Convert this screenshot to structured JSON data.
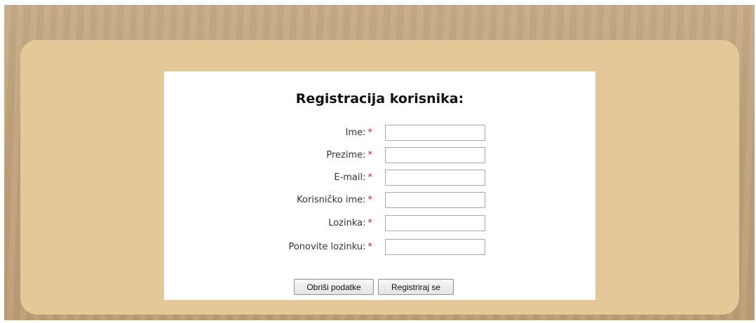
{
  "form": {
    "title": "Registracija korisnika:",
    "required_marker": "*",
    "fields": [
      {
        "label": "Ime:",
        "value": ""
      },
      {
        "label": "Prezime:",
        "value": ""
      },
      {
        "label": "E-mail:",
        "value": ""
      },
      {
        "label": "Korisničko ime:",
        "value": ""
      },
      {
        "label": "Lozinka:",
        "value": ""
      },
      {
        "label": "Ponovite lozinku:",
        "value": ""
      }
    ],
    "buttons": {
      "clear_label": "Obriši podatke",
      "submit_label": "Registriraj se"
    }
  },
  "colors": {
    "outer_background": "#bfa37b",
    "panel_background": "#e4c898",
    "form_background": "#ffffff",
    "required_marker": "#d01818"
  }
}
